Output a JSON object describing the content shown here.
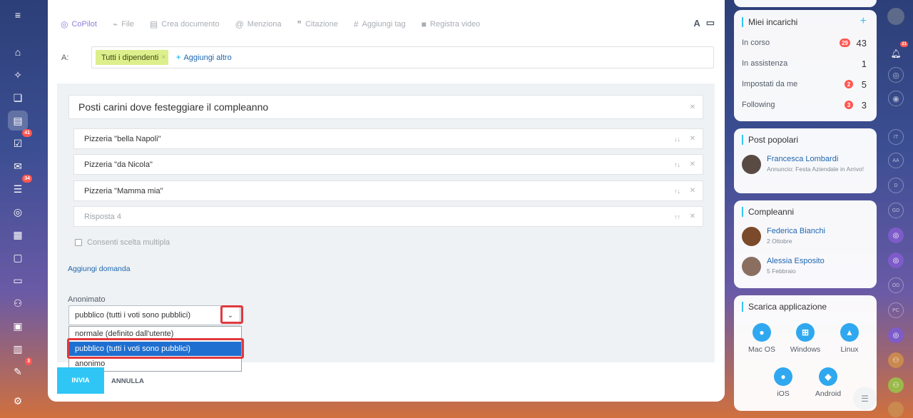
{
  "toolbar": {
    "items": [
      {
        "label": "CoPilot",
        "icon": "copilot-icon"
      },
      {
        "label": "File",
        "icon": "paperclip-icon"
      },
      {
        "label": "Crea documento",
        "icon": "document-icon"
      },
      {
        "label": "Menziona",
        "icon": "at-icon"
      },
      {
        "label": "Citazione",
        "icon": "quote-icon"
      },
      {
        "label": "Aggiungi tag",
        "icon": "hash-icon"
      },
      {
        "label": "Registra video",
        "icon": "video-icon"
      }
    ],
    "format_label": "A"
  },
  "recipients": {
    "to_label": "A:",
    "chip_label": "Tutti i dipendenti",
    "chip_remove": "×",
    "add_more_prefix": "+",
    "add_more": "Aggiungi altro"
  },
  "poll": {
    "question": "Posti carini dove festeggiare il compleanno",
    "answers": [
      {
        "text": "Pizzeria \"bella Napoli\"",
        "sort": "↓↓",
        "placeholder": false
      },
      {
        "text": "Pizzeria \"da Nicola\"",
        "sort": "↑↓",
        "placeholder": false
      },
      {
        "text": "Pizzeria \"Mamma mia\"",
        "sort": "↑↓",
        "placeholder": false
      },
      {
        "text": "Risposta  4",
        "sort": "↑↑",
        "placeholder": true
      }
    ],
    "multiple_choice": "Consenti scelta multipla",
    "add_question": "Aggiungi domanda",
    "anonymity_label": "Anonimato",
    "anonymity_value": "pubblico (tutti i voti sono pubblici)",
    "anonymity_options": [
      "normale (definito dall'utente)",
      "pubblico (tutti i voti sono pubblici)",
      "anonimo"
    ],
    "selected_option_index": 1
  },
  "actions": {
    "send": "INVIA",
    "cancel": "ANNULLA"
  },
  "tasks_widget": {
    "title": "Miei incarichi",
    "add": "+",
    "rows": [
      {
        "label": "In corso",
        "badge": "29",
        "count": "43"
      },
      {
        "label": "In assistenza",
        "badge": "",
        "count": "1"
      },
      {
        "label": "Impostati da me",
        "badge": "2",
        "count": "5"
      },
      {
        "label": "Following",
        "badge": "3",
        "count": "3"
      }
    ]
  },
  "popular_widget": {
    "title": "Post popolari",
    "post": {
      "name": "Francesca Lombardi",
      "subtitle": "Annuncio: Festa Aziendale in Arrivo!"
    }
  },
  "birthdays_widget": {
    "title": "Compleanni",
    "people": [
      {
        "name": "Federica Bianchi",
        "date": "2 Ottobre"
      },
      {
        "name": "Alessia Esposito",
        "date": "5 Febbraio"
      }
    ]
  },
  "apps_widget": {
    "title": "Scarica applicazione",
    "apps": [
      "Mac OS",
      "Windows",
      "Linux",
      "iOS",
      "Android"
    ]
  },
  "left_nav_badges": {
    "tasks": "41",
    "feed": "34",
    "approvals": "3"
  },
  "right_bar": {
    "notifications_badge": "21",
    "initials": [
      "IT",
      "AA",
      "D",
      "GD",
      "OD",
      "PC"
    ]
  },
  "colors": {
    "accent": "#2fc6f6",
    "link": "#2067b0",
    "badge": "#ff5752",
    "highlight": "#e0393e",
    "selected": "#1f6fd0"
  }
}
